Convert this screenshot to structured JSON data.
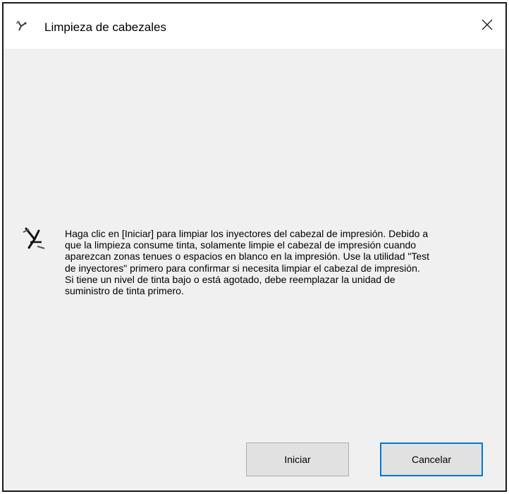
{
  "window": {
    "title": "Limpieza de cabezales",
    "title_icon": "print-head-cleaning-icon",
    "close_icon": "close-icon"
  },
  "content": {
    "icon": "print-head-cleaning-icon",
    "message": "Haga clic en [Iniciar] para limpiar los inyectores del cabezal de impresión. Debido a que la limpieza consume tinta, solamente limpie el cabezal de impresión cuando aparezcan zonas tenues o espacios en blanco en la impresión. Use la utilidad \"Test de inyectores\" primero para confirmar si necesita limpiar el cabezal de impresión. Si tiene un nivel de tinta bajo o está agotado, debe reemplazar la unidad de suministro de tinta primero."
  },
  "buttons": {
    "start_label": "Iniciar",
    "cancel_label": "Cancelar"
  },
  "colors": {
    "focus_border": "#0078d7",
    "dialog_background": "#f0f0f0",
    "button_face": "#e1e1e1"
  }
}
